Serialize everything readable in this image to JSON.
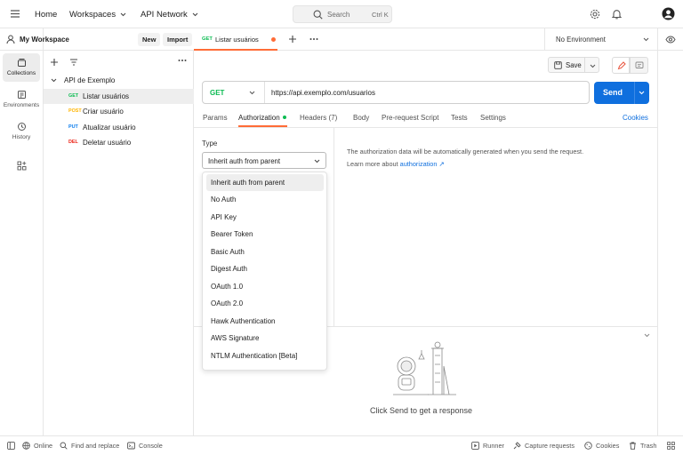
{
  "topbar": {
    "home": "Home",
    "workspaces": "Workspaces",
    "api_network": "API Network",
    "search_placeholder": "Search",
    "search_shortcut": "Ctrl K"
  },
  "rail": {
    "collections": "Collections",
    "environments": "Environments",
    "history": "History"
  },
  "sidebar": {
    "workspace_name": "My Workspace",
    "new_label": "New",
    "import_label": "Import",
    "collection_name": "API de Exemplo",
    "requests": [
      {
        "method": "GET",
        "label": "Listar usuários",
        "color": "#0cbb52"
      },
      {
        "method": "POST",
        "label": "Criar usuário",
        "color": "#ffb400"
      },
      {
        "method": "PUT",
        "label": "Atualizar usuário",
        "color": "#097bed"
      },
      {
        "method": "DEL",
        "label": "Deletar usuário",
        "color": "#eb2013"
      }
    ]
  },
  "tabs": {
    "active_method": "GET",
    "active_title": "Listar usuários",
    "environment": "No Environment"
  },
  "request": {
    "save_label": "Save",
    "method": "GET",
    "url": "https://api.exemplo.com/usuarios",
    "send_label": "Send",
    "subtabs": [
      "Params",
      "Authorization",
      "Headers (7)",
      "Body",
      "Pre-request Script",
      "Tests",
      "Settings"
    ],
    "cookies": "Cookies"
  },
  "auth": {
    "type_label": "Type",
    "selected": "Inherit auth from parent",
    "options": [
      "Inherit auth from parent",
      "No Auth",
      "API Key",
      "Bearer Token",
      "Basic Auth",
      "Digest Auth",
      "OAuth 1.0",
      "OAuth 2.0",
      "Hawk Authentication",
      "AWS Signature",
      "NTLM Authentication [Beta]"
    ],
    "info_text": "The authorization data will be automatically generated when you send the request.",
    "learn_more_prefix": "Learn more about",
    "learn_more_link": "authorization ↗"
  },
  "response": {
    "empty_message": "Click Send to get a response"
  },
  "statusbar": {
    "online": "Online",
    "find_replace": "Find and replace",
    "console": "Console",
    "runner": "Runner",
    "capture": "Capture requests",
    "cookies": "Cookies",
    "trash": "Trash"
  },
  "colors": {
    "accent_orange": "#ff6c37",
    "send_blue": "#0f6fde",
    "link_blue": "#0f6fde",
    "get_green": "#0cbb52"
  }
}
